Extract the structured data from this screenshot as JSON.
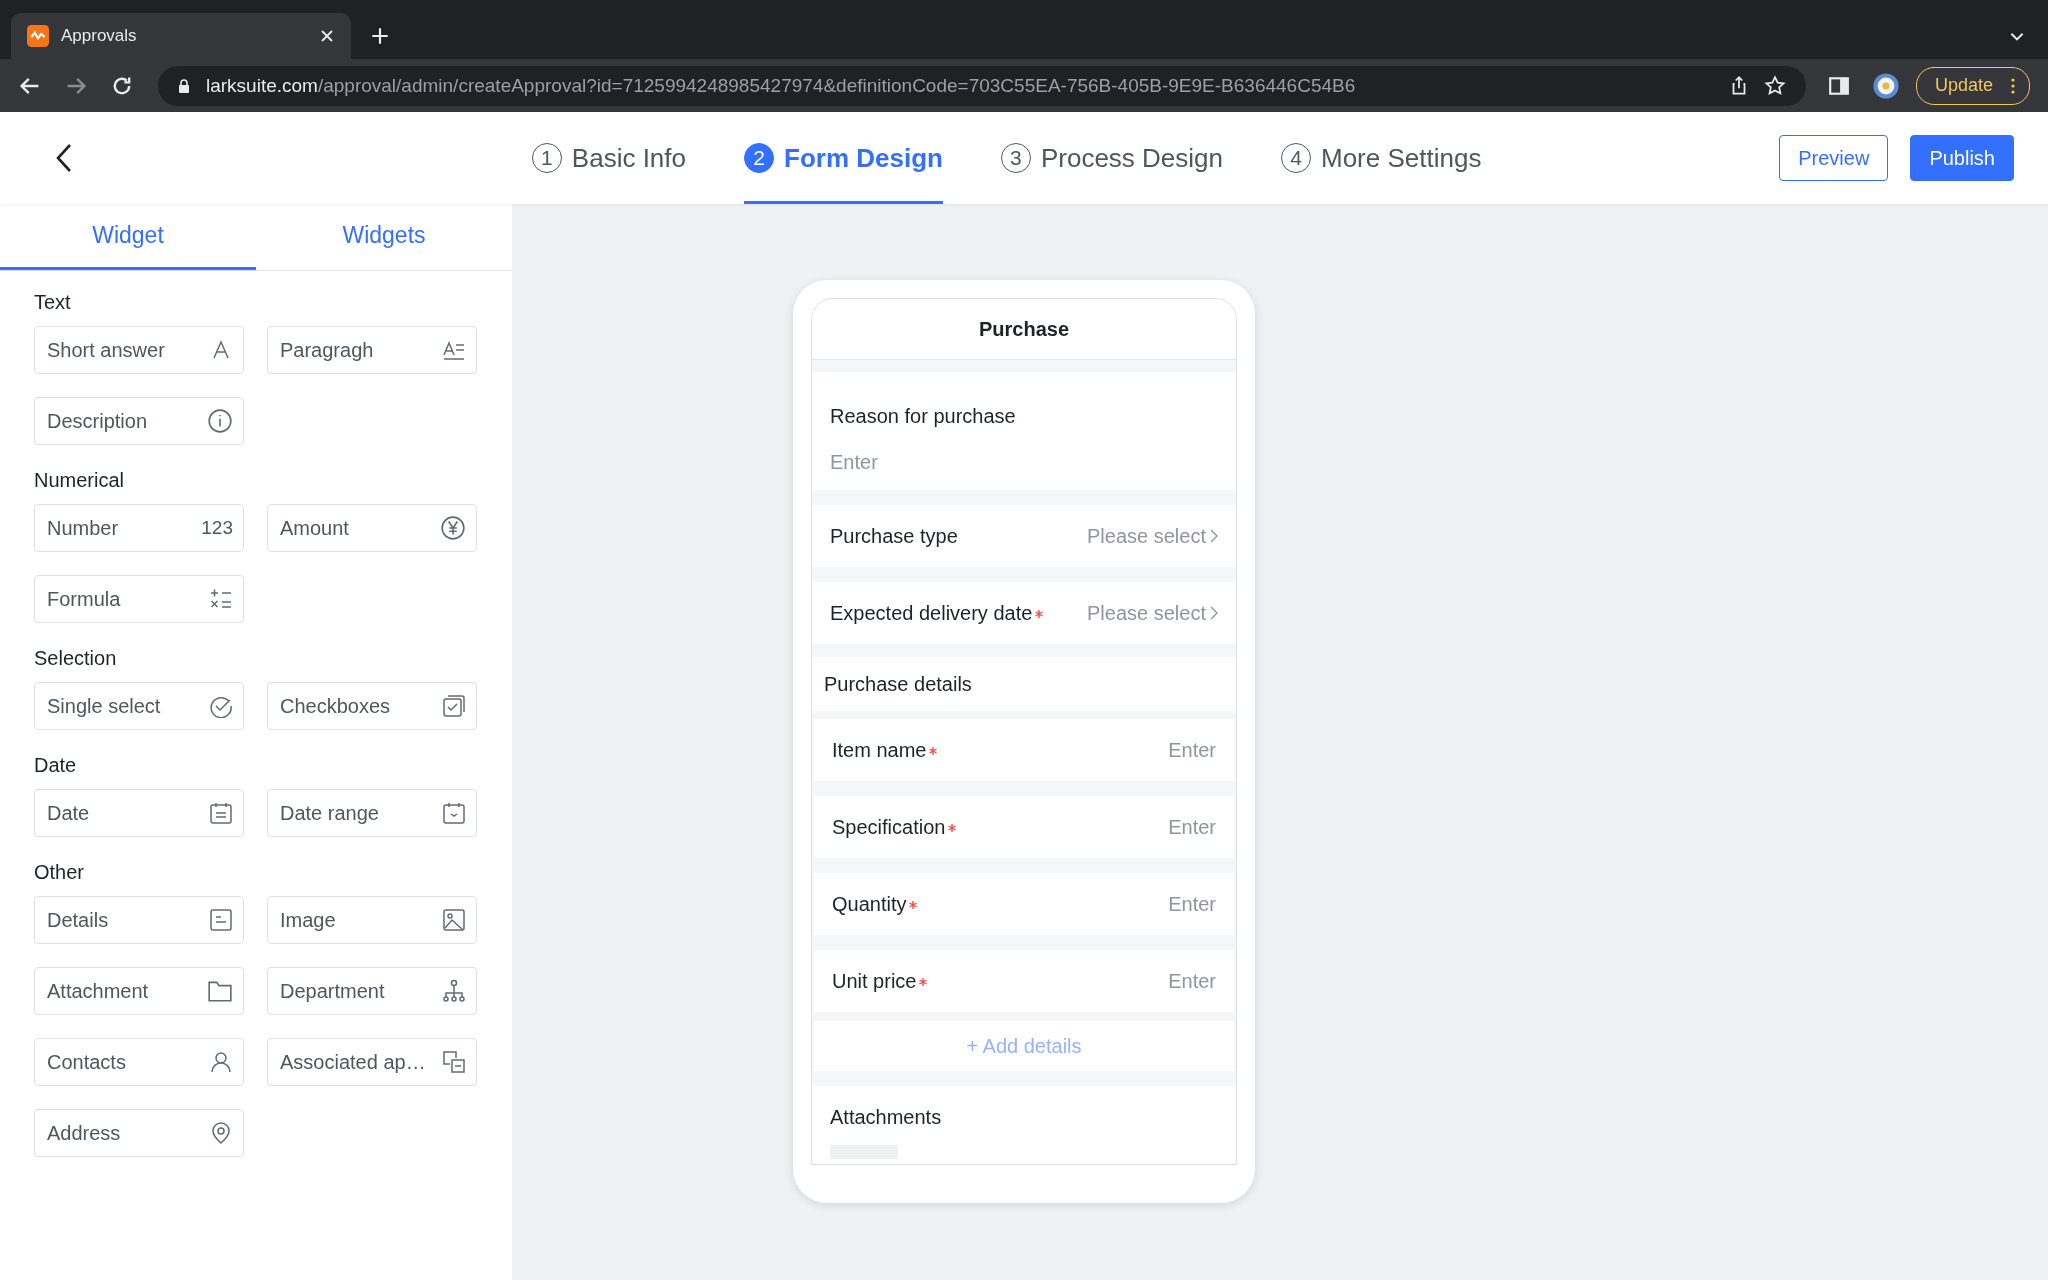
{
  "browser": {
    "tab_title": "Approvals",
    "url_host": "larksuite.com",
    "url_path": "/approval/admin/createApproval?id=7125994248985427974&definitionCode=703C55EA-756B-405B-9E9E-B636446C54B6",
    "update_label": "Update"
  },
  "steps": [
    {
      "number": "1",
      "label": "Basic Info",
      "selected": false
    },
    {
      "number": "2",
      "label": "Form Design",
      "selected": true
    },
    {
      "number": "3",
      "label": "Process Design",
      "selected": false
    },
    {
      "number": "4",
      "label": "More Settings",
      "selected": false
    }
  ],
  "actions": {
    "preview": "Preview",
    "publish": "Publish"
  },
  "panel_tabs": [
    {
      "label": "Widget",
      "selected": true
    },
    {
      "label": "Widgets",
      "selected": false
    }
  ],
  "groups": [
    {
      "title": "Text",
      "widgets": [
        {
          "label": "Short answer",
          "kind": "short-answer"
        },
        {
          "label": "Paragragh",
          "kind": "paragraph"
        },
        {
          "label": "Description",
          "kind": "description"
        }
      ]
    },
    {
      "title": "Numerical",
      "widgets": [
        {
          "label": "Number",
          "kind": "number",
          "icon_text": "123"
        },
        {
          "label": "Amount",
          "kind": "amount"
        },
        {
          "label": "Formula",
          "kind": "formula"
        }
      ]
    },
    {
      "title": "Selection",
      "widgets": [
        {
          "label": "Single select",
          "kind": "single-select"
        },
        {
          "label": "Checkboxes",
          "kind": "checkboxes"
        }
      ]
    },
    {
      "title": "Date",
      "widgets": [
        {
          "label": "Date",
          "kind": "date"
        },
        {
          "label": "Date range",
          "kind": "date-range"
        }
      ]
    },
    {
      "title": "Other",
      "widgets": [
        {
          "label": "Details",
          "kind": "details"
        },
        {
          "label": "Image",
          "kind": "image"
        },
        {
          "label": "Attachment",
          "kind": "attachment"
        },
        {
          "label": "Department",
          "kind": "department"
        },
        {
          "label": "Contacts",
          "kind": "contacts"
        },
        {
          "label": "Associated ap…",
          "kind": "associated"
        },
        {
          "label": "Address",
          "kind": "address"
        }
      ]
    }
  ],
  "form": {
    "title": "Purchase",
    "fields": [
      {
        "kind": "textarea",
        "label": "Reason for purchase",
        "placeholder": "Enter",
        "required": false
      },
      {
        "kind": "select",
        "label": "Purchase type",
        "placeholder": "Please select",
        "required": false
      },
      {
        "kind": "select",
        "label": "Expected delivery date",
        "placeholder": "Please select",
        "required": true
      },
      {
        "kind": "section",
        "label": "Purchase details"
      },
      {
        "kind": "input",
        "label": "Item name",
        "placeholder": "Enter",
        "required": true
      },
      {
        "kind": "input",
        "label": "Specification",
        "placeholder": "Enter",
        "required": true
      },
      {
        "kind": "input",
        "label": "Quantity",
        "placeholder": "Enter",
        "required": true
      },
      {
        "kind": "input",
        "label": "Unit price",
        "placeholder": "Enter",
        "required": true
      },
      {
        "kind": "add",
        "label": "+ Add details"
      },
      {
        "kind": "attachments",
        "label": "Attachments"
      }
    ]
  }
}
